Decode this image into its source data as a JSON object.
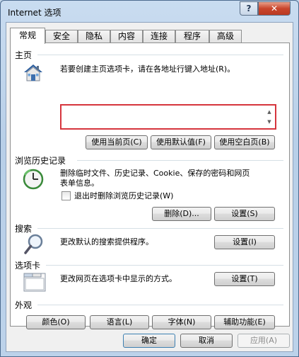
{
  "window": {
    "title": "Internet 选项",
    "help_label": "?",
    "close_label": "✕"
  },
  "tabs": [
    {
      "label": "常规",
      "active": true
    },
    {
      "label": "安全"
    },
    {
      "label": "隐私"
    },
    {
      "label": "内容"
    },
    {
      "label": "连接"
    },
    {
      "label": "程序"
    },
    {
      "label": "高级"
    }
  ],
  "home": {
    "label": "主页",
    "description": "若要创建主页选项卡，请在各地址行键入地址(R)。",
    "url_value": "",
    "btn_current": "使用当前页(C)",
    "btn_default": "使用默认值(F)",
    "btn_blank": "使用空白页(B)"
  },
  "history": {
    "label": "浏览历史记录",
    "description_line1": "删除临时文件、历史记录、Cookie、保存的密码和网页",
    "description_line2": "表单信息。",
    "checkbox_label": "退出时删除浏览历史记录(W)",
    "checkbox_checked": false,
    "btn_delete": "删除(D)...",
    "btn_settings": "设置(S)"
  },
  "search": {
    "label": "搜索",
    "description": "更改默认的搜索提供程序。",
    "btn_settings": "设置(I)"
  },
  "tabs_section": {
    "label": "选项卡",
    "description": "更改网页在选项卡中显示的方式。",
    "btn_settings": "设置(T)"
  },
  "appearance": {
    "label": "外观",
    "btn_colors": "颜色(O)",
    "btn_languages": "语言(L)",
    "btn_fonts": "字体(N)",
    "btn_accessibility": "辅助功能(E)"
  },
  "footer": {
    "btn_ok": "确定",
    "btn_cancel": "取消",
    "btn_apply": "应用(A)"
  }
}
